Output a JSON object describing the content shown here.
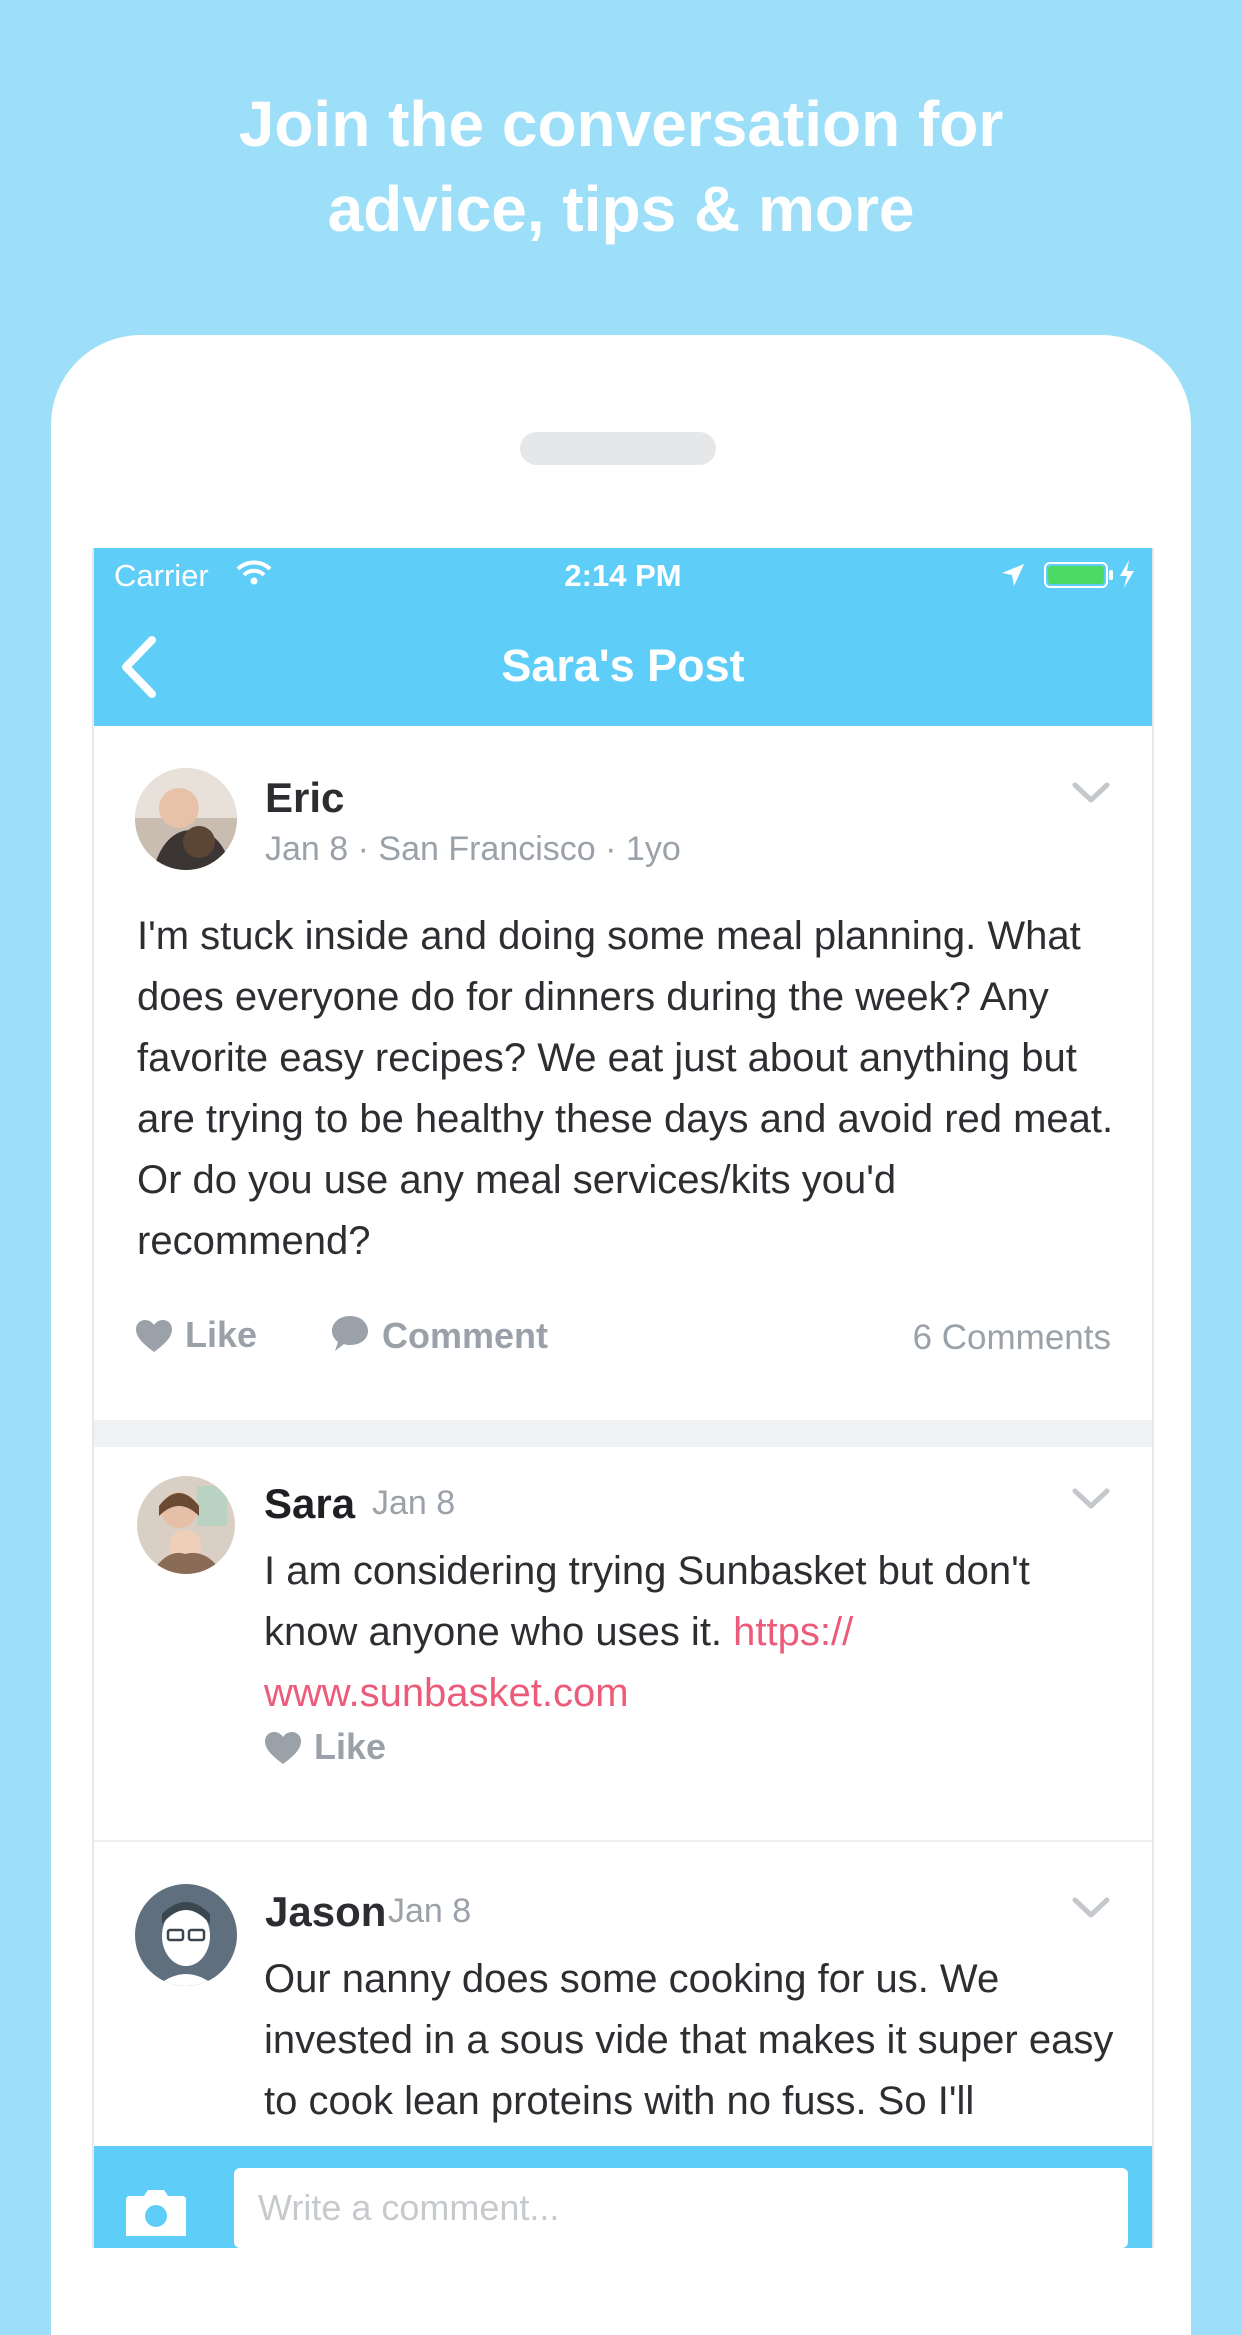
{
  "headline": {
    "line1": "Join the conversation for",
    "line2": "advice, tips & more"
  },
  "status_bar": {
    "carrier": "Carrier",
    "time": "2:14 PM"
  },
  "nav": {
    "title": "Sara's Post",
    "back_icon": "chevron-left-icon"
  },
  "post": {
    "author": "Eric",
    "meta": "Jan 8 · San Francisco · 1yo",
    "text": "I'm stuck inside and doing some meal planning. What does everyone do for dinners during the week? Any favorite easy recipes? We eat just about anything but are trying to be healthy these days and avoid red meat. Or do you use any meal services/kits you'd recommend?",
    "like_label": "Like",
    "comment_label": "Comment",
    "comments_count": "6 Comments"
  },
  "comments": [
    {
      "author": "Sara",
      "date": "Jan 8",
      "text": "I am considering trying Sunbasket but don't know anyone who uses it. ",
      "link_line1": "https://",
      "link_line2": "www.sunbasket.com",
      "like_label": "Like"
    },
    {
      "author": "Jason",
      "date": "Jan 8",
      "text": "Our nanny does some cooking for us. We invested in a sous vide that makes it super easy to cook lean proteins with no fuss. So I'll"
    }
  ],
  "composer": {
    "placeholder": "Write a comment..."
  },
  "colors": {
    "background": "#9ddff9",
    "nav": "#5ecdf8",
    "link": "#ec5c7a",
    "muted": "#9ba1a8"
  }
}
